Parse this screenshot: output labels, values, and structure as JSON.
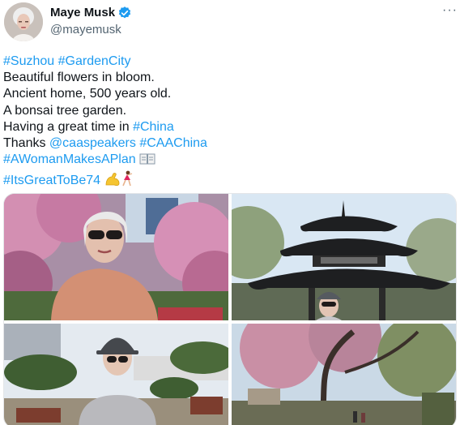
{
  "author": {
    "display_name": "Maye Musk",
    "handle": "@mayemusk",
    "verified": true,
    "avatar_icon": "avatar-photo"
  },
  "more_label": "···",
  "tweet": {
    "lines": [
      [
        {
          "text": "#Suzhou",
          "type": "hashtag"
        },
        {
          "text": " ",
          "type": "text"
        },
        {
          "text": "#GardenCity",
          "type": "hashtag"
        }
      ],
      [
        {
          "text": "Beautiful flowers in bloom.",
          "type": "text"
        }
      ],
      [
        {
          "text": "Ancient home, 500 years old.",
          "type": "text"
        }
      ],
      [
        {
          "text": "A bonsai tree garden.",
          "type": "text"
        }
      ],
      [
        {
          "text": "Having a great time in ",
          "type": "text"
        },
        {
          "text": "#China",
          "type": "hashtag"
        }
      ],
      [
        {
          "text": "Thanks ",
          "type": "text"
        },
        {
          "text": "@caaspeakers",
          "type": "mention"
        },
        {
          "text": " ",
          "type": "text"
        },
        {
          "text": "#CAAChina",
          "type": "hashtag"
        }
      ],
      [
        {
          "text": "#AWomanMakesAPlan",
          "type": "hashtag"
        },
        {
          "text": " ",
          "type": "text"
        },
        {
          "text": "book-emoji",
          "type": "emoji"
        }
      ],
      [
        {
          "text": "#ItsGreatToBe74",
          "type": "hashtag"
        },
        {
          "text": " ",
          "type": "text"
        },
        {
          "text": "flexed-biceps-emoji",
          "type": "emoji"
        },
        {
          "text": "dancer-emoji",
          "type": "emoji"
        }
      ]
    ]
  },
  "media": {
    "photos": [
      {
        "name": "photo-cherry-blossom-portrait",
        "scene": "blossom"
      },
      {
        "name": "photo-pagoda",
        "scene": "pagoda"
      },
      {
        "name": "photo-bonsai-garden",
        "scene": "bonsai"
      },
      {
        "name": "photo-garden-path",
        "scene": "path"
      }
    ]
  },
  "colors": {
    "link": "#1d9bf0",
    "verified": "#1d9bf0",
    "text": "#0f1419",
    "secondary": "#536471"
  }
}
